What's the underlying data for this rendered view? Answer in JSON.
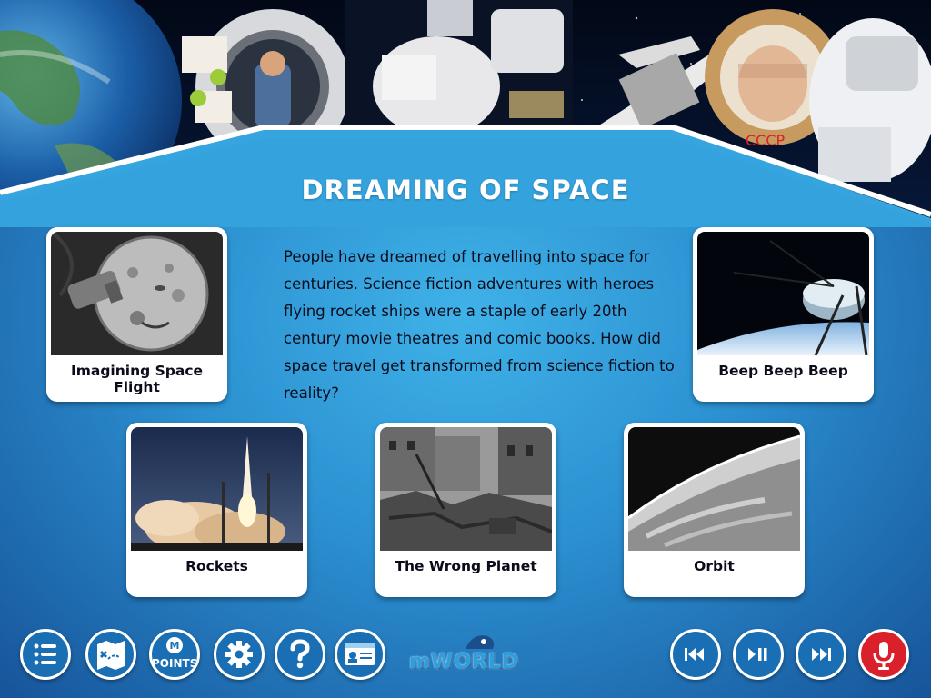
{
  "page": {
    "title": "DREAMING OF SPACE",
    "intro": "People have dreamed of travelling into space for centuries. Science fiction adventures with heroes flying rocket ships were a staple of early 20th century movie theatres and comic books. How did space travel get transformed from science fiction to reality?"
  },
  "cards": [
    {
      "label": "Imagining Space Flight",
      "image": "moon-face-film-still"
    },
    {
      "label": "Beep Beep Beep",
      "image": "sputnik-satellite"
    },
    {
      "label": "Rockets",
      "image": "rocket-launch"
    },
    {
      "label": "The Wrong Planet",
      "image": "bomb-damaged-city"
    },
    {
      "label": "Orbit",
      "image": "earth-from-space"
    }
  ],
  "toolbar": {
    "points_label": "POINTS",
    "points_badge": "M",
    "logo_text": "mWORLD",
    "icons": [
      "menu-icon",
      "map-icon",
      "points-icon",
      "settings-icon",
      "help-icon",
      "id-card-icon",
      "rewind-icon",
      "play-pause-icon",
      "fast-forward-icon",
      "microphone-icon"
    ]
  },
  "colors": {
    "accent": "#1a6fb4",
    "record": "#d9202b",
    "background": "#2b8fd0"
  }
}
